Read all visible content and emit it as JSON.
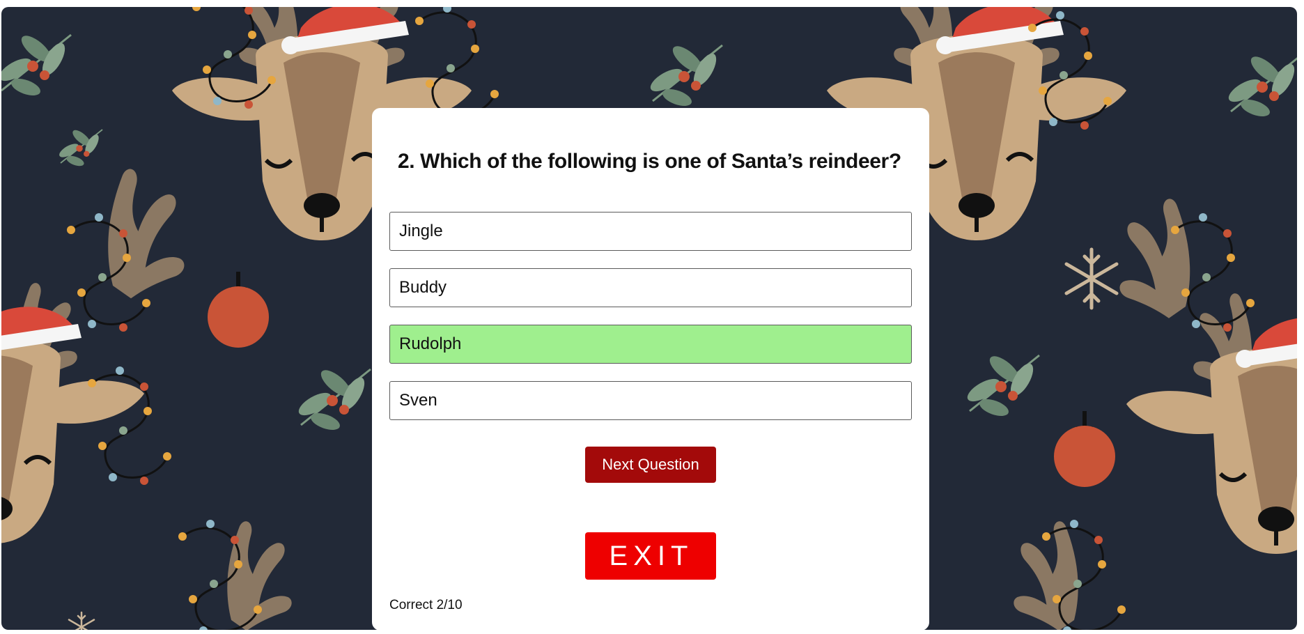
{
  "quiz": {
    "question": "2. Which of the following is one of Santa’s reindeer?",
    "answers": [
      {
        "label": "Jingle",
        "state": "default"
      },
      {
        "label": "Buddy",
        "state": "default"
      },
      {
        "label": "Rudolph",
        "state": "correct"
      },
      {
        "label": "Sven",
        "state": "default"
      }
    ],
    "next_label": "Next Question",
    "exit_label": "EXIT",
    "score_text": "Correct 2/10"
  },
  "theme": {
    "background": "#222937",
    "card": "#ffffff",
    "correct_answer": "#9fef8e",
    "next_button": "#a30a0a",
    "exit_button": "#ee0000",
    "fur": "#c9a982",
    "fur_dark": "#9b7a5c",
    "santa_hat": "#d9493a",
    "ornament": "#c95437",
    "leaf": "#7d9a82"
  },
  "background_pattern": {
    "icons": [
      "reindeer-icon",
      "santa-hat-icon",
      "ornament-icon",
      "mistletoe-icon",
      "snowflake-icon",
      "string-lights-icon"
    ]
  }
}
